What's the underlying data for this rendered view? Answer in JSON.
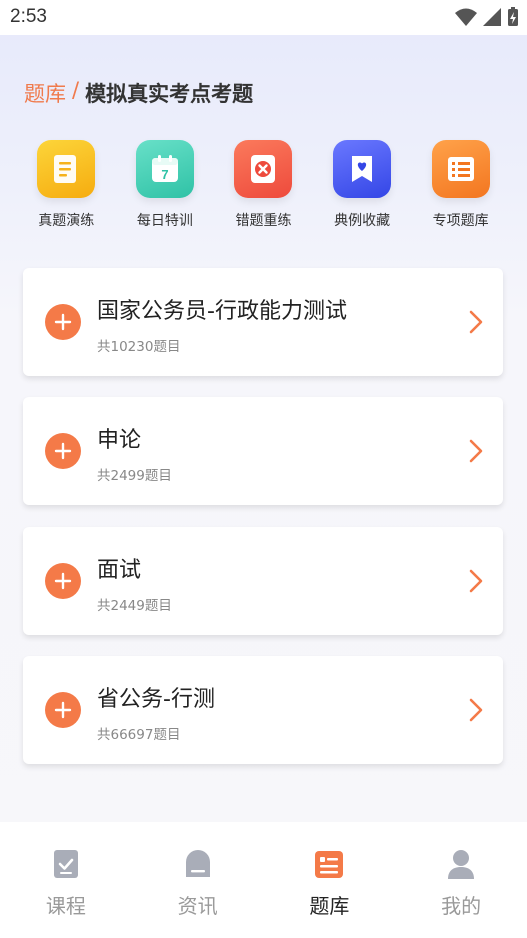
{
  "status": {
    "time": "2:53"
  },
  "breadcrumb": {
    "root": "题库",
    "separator": "/",
    "current": "模拟真实考点考题"
  },
  "quick_actions": [
    {
      "label": "真题演练",
      "icon": "document-icon",
      "color": "#f9c21a"
    },
    {
      "label": "每日特训",
      "icon": "calendar-icon",
      "color": "#45d0b6"
    },
    {
      "label": "错题重练",
      "icon": "wrong-icon",
      "color": "#f25a4c"
    },
    {
      "label": "典例收藏",
      "icon": "bookmark-heart-icon",
      "color": "#4b5cf0"
    },
    {
      "label": "专项题库",
      "icon": "list-icon",
      "color": "#f7882c"
    }
  ],
  "banks": [
    {
      "title": "国家公务员-行政能力测试",
      "count": "共10230题目"
    },
    {
      "title": "申论",
      "count": "共2499题目"
    },
    {
      "title": "面试",
      "count": "共2449题目"
    },
    {
      "title": "省公务-行测",
      "count": "共66697题目"
    }
  ],
  "tabs": [
    {
      "label": "课程",
      "icon": "course-icon",
      "active": false
    },
    {
      "label": "资讯",
      "icon": "news-icon",
      "active": false
    },
    {
      "label": "题库",
      "icon": "question-bank-icon",
      "active": true
    },
    {
      "label": "我的",
      "icon": "profile-icon",
      "active": false
    }
  ],
  "colors": {
    "accent": "#f47a48",
    "text": "#222222",
    "muted": "#888888",
    "tab_inactive": "#9a9a9a"
  }
}
